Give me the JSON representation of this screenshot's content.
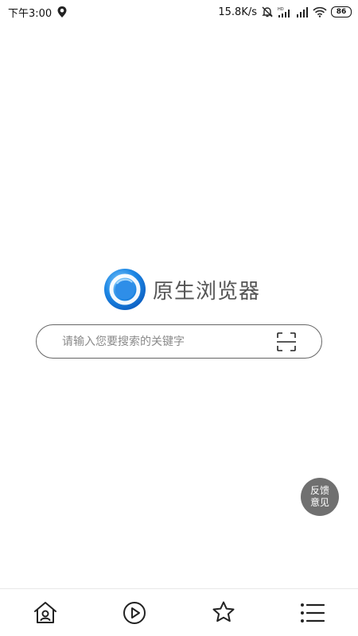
{
  "status_bar": {
    "time": "下午3:00",
    "network_speed": "15.8K/s",
    "battery_level": "86",
    "icons": [
      "location-icon",
      "alarm-off-icon",
      "hd-signal-icon",
      "signal-icon",
      "wifi-icon",
      "battery-icon"
    ]
  },
  "brand": {
    "name": "原生浏览器",
    "logo": "browser-logo-icon",
    "accent_color": "#1e88e5"
  },
  "search": {
    "placeholder": "请输入您要搜索的关键字",
    "value": "",
    "scan_icon": "scan-icon"
  },
  "feedback": {
    "line1": "反馈",
    "line2": "意见",
    "color": "#707070"
  },
  "bottom_nav": {
    "items": [
      {
        "icon": "home-icon"
      },
      {
        "icon": "play-icon"
      },
      {
        "icon": "star-icon"
      },
      {
        "icon": "menu-list-icon"
      }
    ]
  }
}
